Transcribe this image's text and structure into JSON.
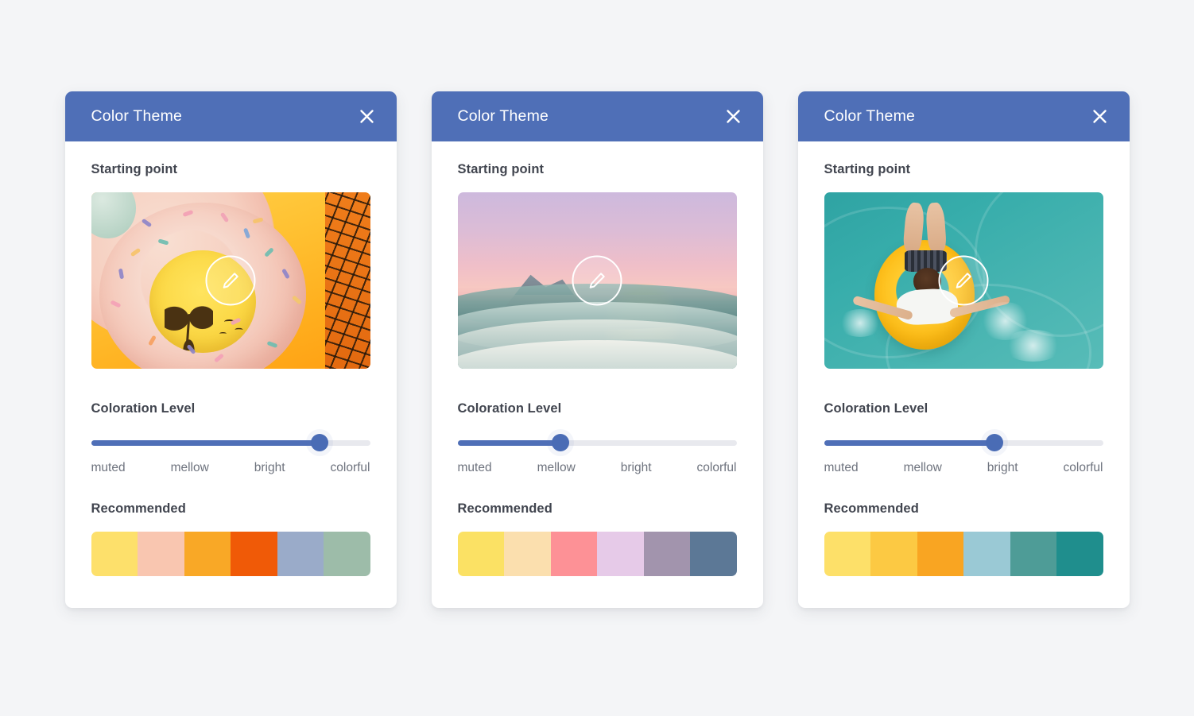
{
  "page": {
    "background_color": "#f4f5f7"
  },
  "theme": {
    "header_blue": "#4f6fb7",
    "slider_blue": "#4a6cb5",
    "track_gray": "#e8e9ee",
    "heading_color": "#41454f",
    "label_color": "#6e737e"
  },
  "icons": {
    "close": "close-icon",
    "edit": "pencil-icon"
  },
  "cards": [
    {
      "title": "Color Theme",
      "close_label": "X",
      "starting_point_label": "Starting point",
      "image_alt": "pink donut pool float with sprinkles",
      "edit_icon_label": "pencil-icon",
      "coloration_label": "Coloration Level",
      "slider": {
        "value_percent": 82,
        "selected_label": "colorful",
        "scale": [
          "muted",
          "mellow",
          "bright",
          "colorful"
        ]
      },
      "recommended_label": "Recommended",
      "swatches": [
        "#fde06b",
        "#f9c6b0",
        "#f9a826",
        "#f05a07",
        "#9aabc9",
        "#9dbca9"
      ]
    },
    {
      "title": "Color Theme",
      "close_label": "X",
      "starting_point_label": "Starting point",
      "image_alt": "pink sunset over teal ocean waves",
      "edit_icon_label": "pencil-icon",
      "coloration_label": "Coloration Level",
      "slider": {
        "value_percent": 37,
        "selected_label": "mellow",
        "scale": [
          "muted",
          "mellow",
          "bright",
          "colorful"
        ]
      },
      "recommended_label": "Recommended",
      "swatches": [
        "#fbe164",
        "#fbdfae",
        "#fd9196",
        "#e6cae8",
        "#a294ad",
        "#5c7896"
      ]
    },
    {
      "title": "Color Theme",
      "close_label": "X",
      "starting_point_label": "Starting point",
      "image_alt": "person floating on yellow ring in turquoise pool",
      "edit_icon_label": "pencil-icon",
      "coloration_label": "Coloration Level",
      "slider": {
        "value_percent": 61,
        "selected_label": "bright",
        "scale": [
          "muted",
          "mellow",
          "bright",
          "colorful"
        ]
      },
      "recommended_label": "Recommended",
      "swatches": [
        "#fde069",
        "#fcc943",
        "#f9a522",
        "#9ac9d5",
        "#4e9c97",
        "#1f8e8d"
      ]
    }
  ]
}
